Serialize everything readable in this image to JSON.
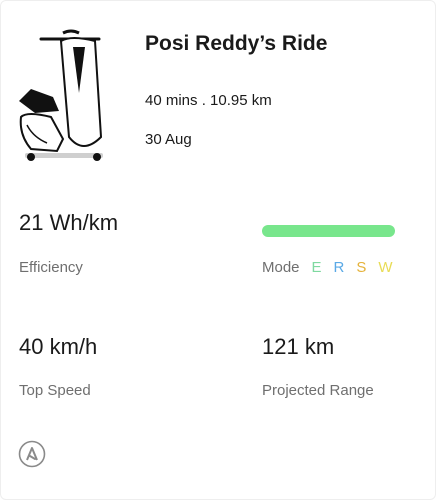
{
  "ride": {
    "title": "Posi Reddy’s Ride",
    "meta": "40 mins . 10.95 km",
    "date": "30 Aug"
  },
  "stats": {
    "efficiency": {
      "value": "21 Wh/km",
      "label": "Efficiency"
    },
    "top_speed": {
      "value": "40 km/h",
      "label": "Top Speed"
    },
    "projected_range": {
      "value": "121 km",
      "label": "Projected Range"
    }
  },
  "mode": {
    "label": "Mode",
    "bar_fill": 1.0,
    "bar_color": "#78e68c",
    "letters": [
      {
        "text": "E",
        "color": "#7fd9a0"
      },
      {
        "text": "R",
        "color": "#5aa9e6"
      },
      {
        "text": "S",
        "color": "#e5b23a"
      },
      {
        "text": "W",
        "color": "#e8dc55"
      }
    ]
  },
  "icons": {
    "vehicle": "scooter-illustration",
    "brand": "brand-logo-icon"
  }
}
